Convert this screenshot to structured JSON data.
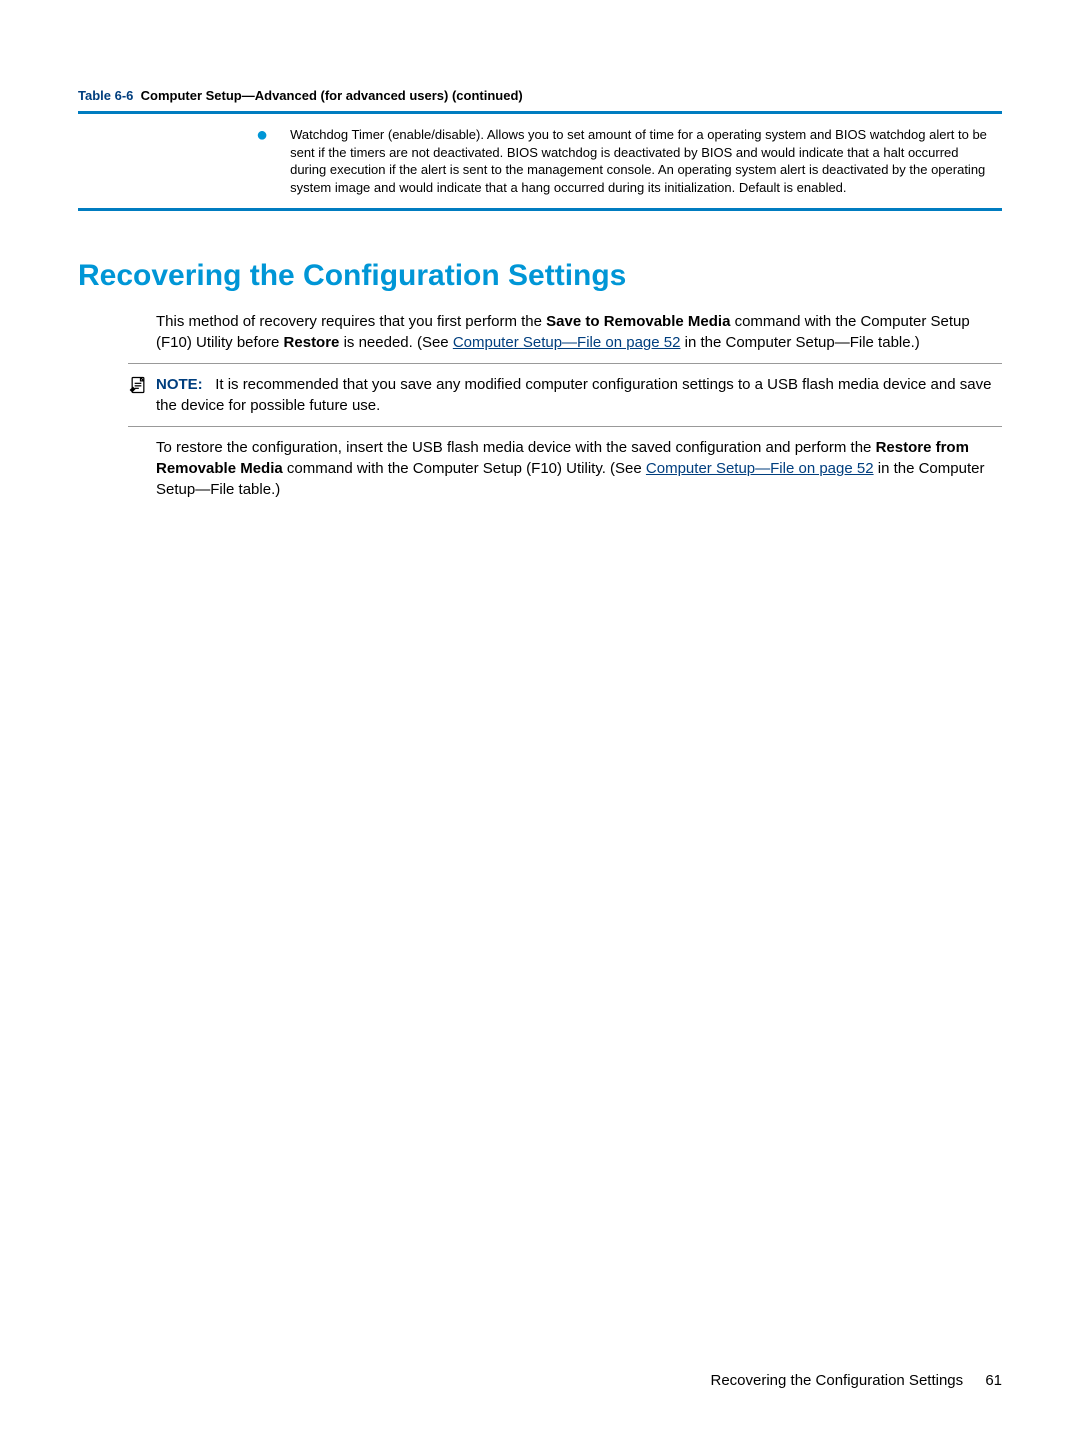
{
  "table": {
    "caption_label": "Table 6-6",
    "caption_title": "Computer Setup—Advanced (for advanced users) (continued)",
    "bullet_text": "Watchdog Timer (enable/disable). Allows you to set amount of time for a operating system and BIOS watchdog alert to be sent if the timers are not deactivated. BIOS watchdog is deactivated by BIOS and would indicate that a halt occurred during execution if the alert is sent to the management console. An operating system alert is deactivated by the operating system image and would indicate that a hang occurred during its initialization. Default is enabled."
  },
  "heading": "Recovering the Configuration Settings",
  "para1": {
    "pre": "This method of recovery requires that you first perform the ",
    "bold1": "Save to Removable Media",
    "mid1": " command with the Computer Setup (F10) Utility before ",
    "bold2": "Restore",
    "mid2": " is needed. (See ",
    "link": "Computer Setup—File on page 52",
    "post": " in the Computer Setup—File table.)"
  },
  "note": {
    "label": "NOTE:",
    "text": "It is recommended that you save any modified computer configuration settings to a USB flash media device and save the device for possible future use."
  },
  "para2": {
    "pre": "To restore the configuration, insert the USB flash media device with the saved configuration and perform the ",
    "bold1": "Restore from Removable Media",
    "mid1": " command with the Computer Setup (F10) Utility. (See ",
    "link": "Computer Setup—File on page 52",
    "post": " in the Computer Setup—File table.)"
  },
  "footer": {
    "title": "Recovering the Configuration Settings",
    "page": "61"
  }
}
